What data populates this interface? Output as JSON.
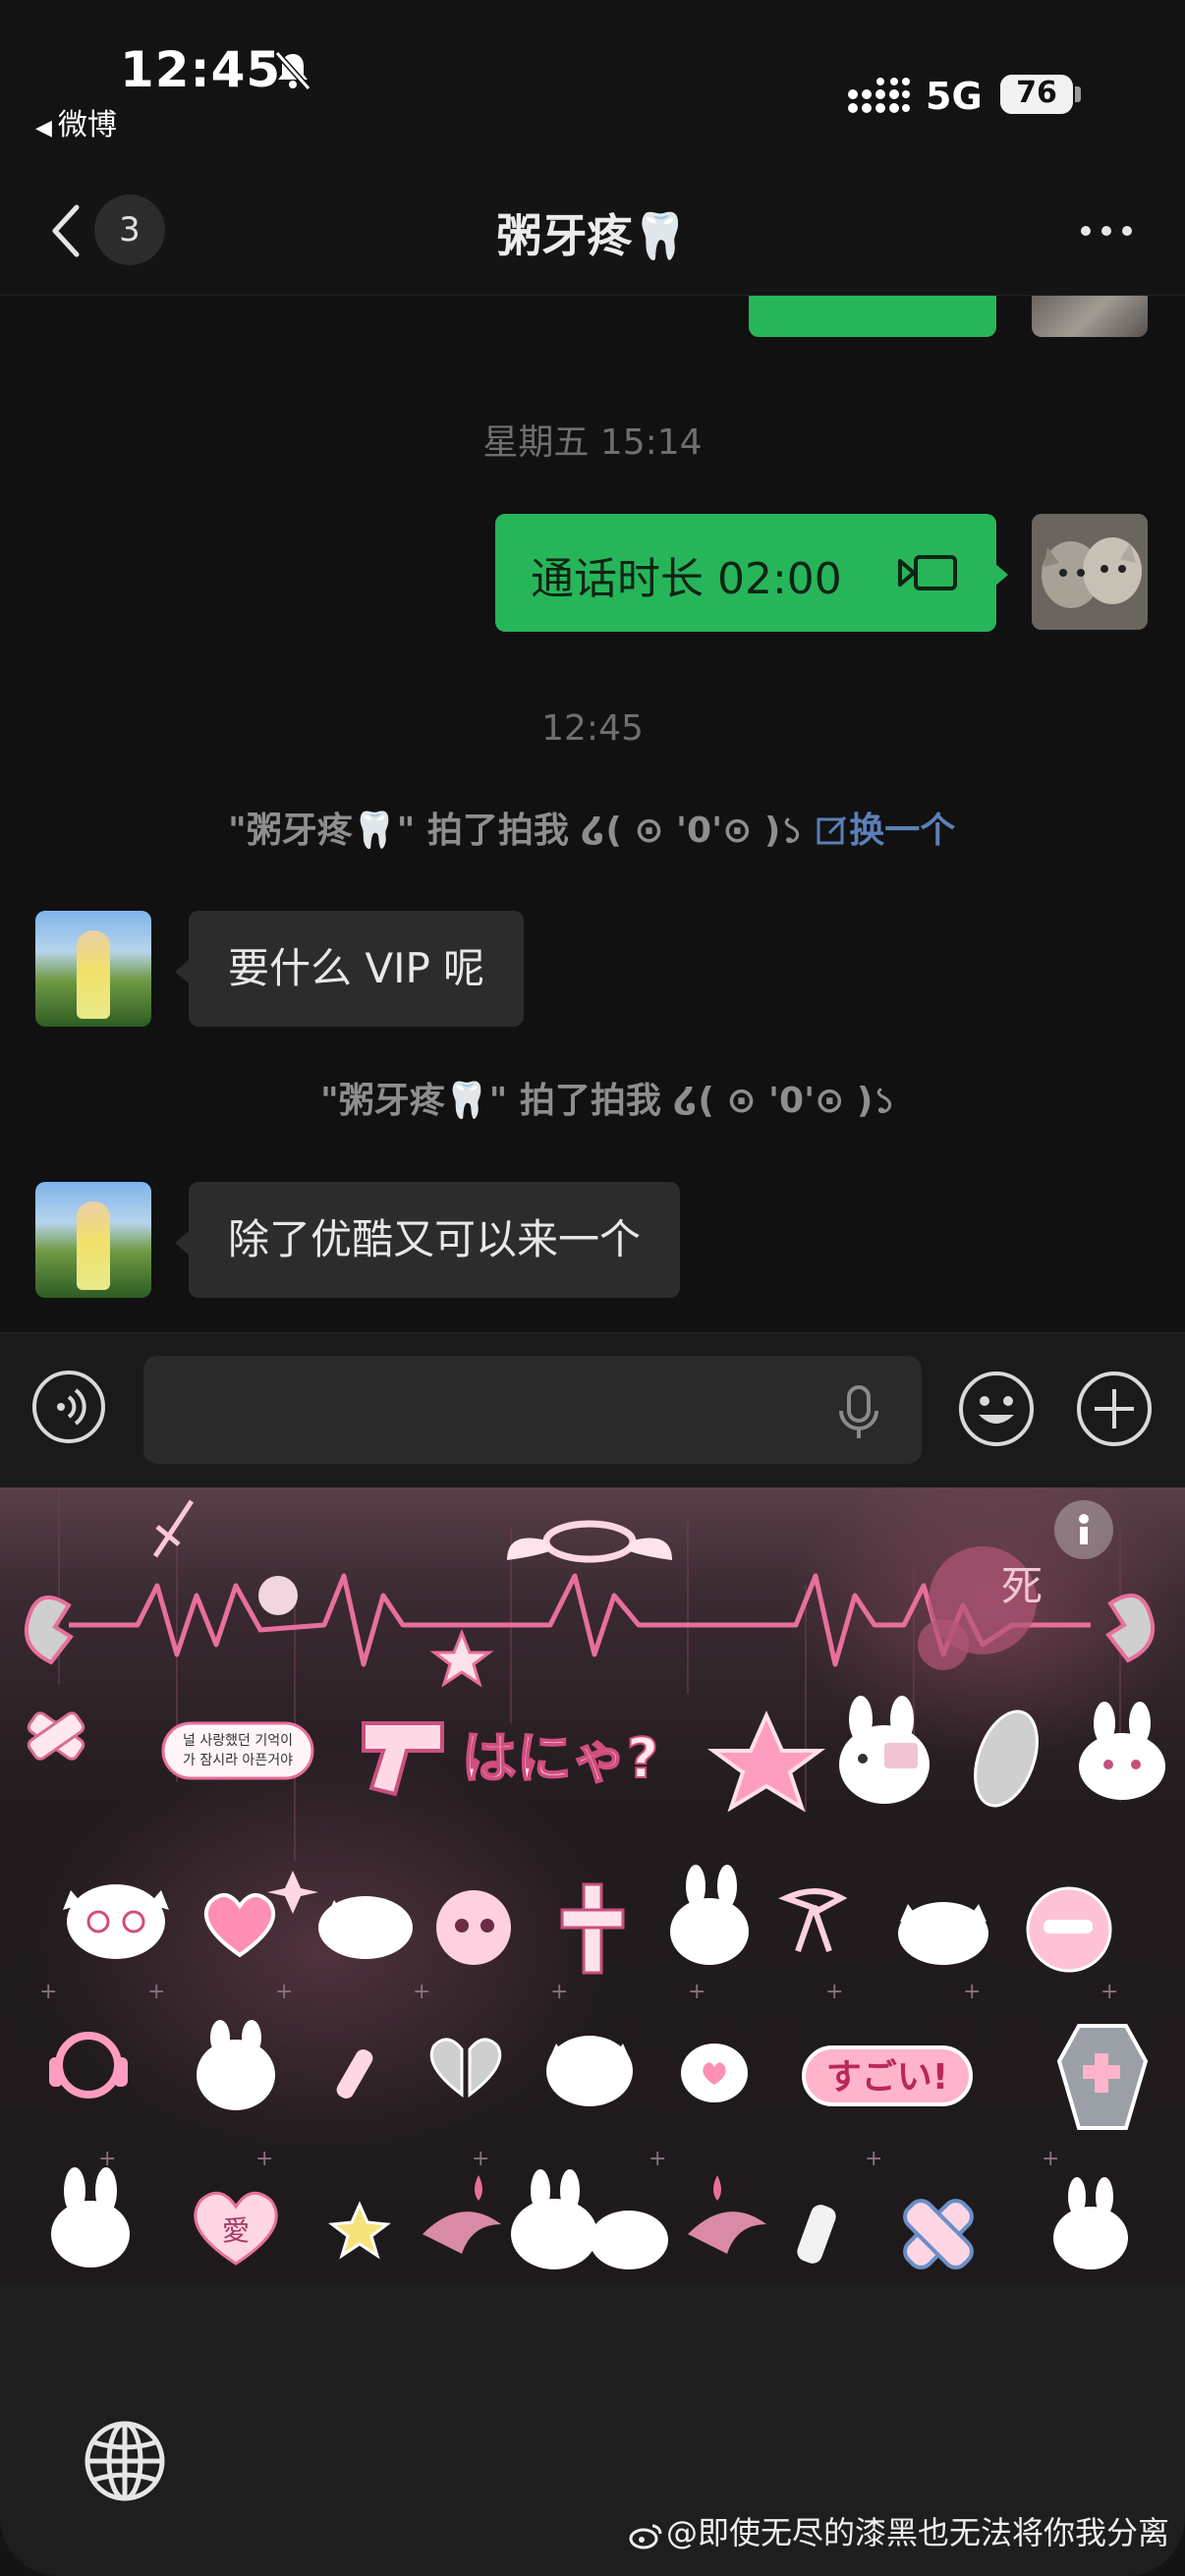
{
  "status_bar": {
    "time": "12:45",
    "back_app": "微博",
    "network": "5G",
    "battery": "76",
    "battery_level": 0.76,
    "icons": [
      "bell-slash-icon",
      "signal-dots-icon",
      "battery-icon"
    ]
  },
  "nav": {
    "unread_count": "3",
    "title": "粥牙疼🦷",
    "icons": [
      "back-chevron-icon",
      "more-dots-icon"
    ]
  },
  "chat": {
    "timestamp_1": "星期五 15:14",
    "call_label": "通话时长 02:00",
    "timestamp_2": "12:45",
    "pat_1": "\"粥牙疼🦷\" 拍了拍我 ໒( ⊙ '0'⊙ )১",
    "pat_1_action": "换一个",
    "message_1": "要什么 VIP 呢",
    "pat_2": "\"粥牙疼🦷\" 拍了拍我 ໒( ⊙ '0'⊙ )১",
    "message_2": "除了优酷又可以来一个",
    "colors": {
      "sent_bubble": "#27b55a",
      "received_bubble": "#2c2c2c",
      "link": "#5b7fb8"
    }
  },
  "input_bar": {
    "icons": [
      "voice-icon",
      "mic-icon",
      "emoji-icon",
      "plus-icon"
    ]
  },
  "sticker_panel": {
    "sticker_texts": [
      "はにゃ?",
      "すごい!",
      "愛",
      "死"
    ],
    "note_text": [
      "널 사랑했던 기억이",
      "가 잠시라 아픈거야"
    ],
    "icons": [
      "info-icon",
      "globe-icon"
    ]
  },
  "watermark": "@即使无尽的漆黑也无法将你我分离"
}
